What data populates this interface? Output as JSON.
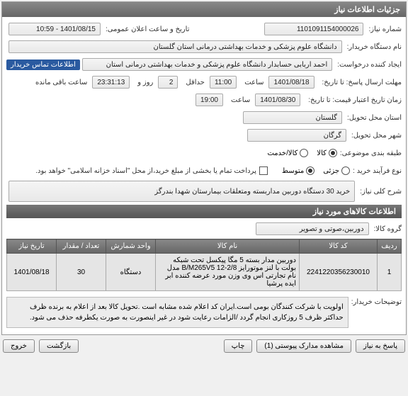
{
  "panel_title": "جزئیات اطلاعات نیاز",
  "fields": {
    "need_number_label": "شماره نیاز:",
    "need_number": "1101091154000026",
    "announce_label": "تاریخ و ساعت اعلان عمومی:",
    "announce_value": "1401/08/15 - 10:59",
    "buyer_org_label": "نام دستگاه خریدار:",
    "buyer_org": "دانشگاه علوم پزشکی و خدمات بهداشتی درمانی استان گلستان",
    "creator_label": "ایجاد کننده درخواست:",
    "creator": "احمد اربابی حسابدار دانشگاه علوم پزشکی و خدمات بهداشتی درمانی استان",
    "contact_badge": "اطلاعات تماس خریدار",
    "deadline_label": "مهلت ارسال پاسخ: تا تاریخ:",
    "deadline_date": "1401/08/18",
    "time_label": "ساعت",
    "deadline_time": "11:00",
    "day_and_label": "روز و",
    "days_value": "2",
    "remaining_time": "23:31:13",
    "remaining_label": "ساعت باقی مانده",
    "min_label": "حداقل",
    "credit_label": "زمان تاریخ اعتبار قیمت: تا تاریخ:",
    "credit_date": "1401/08/30",
    "credit_time": "19:00",
    "province_label": "استان محل تحویل:",
    "province": "گلستان",
    "city_label": "شهر محل تحویل:",
    "city": "گرگان",
    "budget_label": "طبقه بندی موضوعی:",
    "budget_opts": {
      "kala": "کالا",
      "khadamat": "کالا/خدمت"
    },
    "process_label": "نوع فرآیند خرید :",
    "process_opts": {
      "joz": "جزئی",
      "moto": "متوسط"
    },
    "payment_text": "پرداخت تمام یا بخشی از مبلغ خرید،از محل \"اسناد خزانه اسلامی\" خواهد بود.",
    "summary_label": "شرح کلی نیاز:",
    "summary": "خرید 30 دستگاه دوربین مداربسته ومتعلقات بیمارستان شهدا بندرگز"
  },
  "items_section": {
    "header": "اطلاعات کالاهای مورد نیاز",
    "group_label": "گروه کالا:",
    "group_value": "دوربین،صوتی و تصویر"
  },
  "table": {
    "headers": [
      "ردیف",
      "کد کالا",
      "نام کالا",
      "واحد شمارش",
      "تعداد / مقدار",
      "تاریخ نیاز"
    ],
    "rows": [
      {
        "idx": "1",
        "code": "2241220356230010",
        "name": "دوربین مدار بسته 5 مگا پیکسل تحت شبکه بولت با لنز موتورایز B/M265V5 12-2/8 مدل نام تجارتی اس وی وزن مورد عرضه کننده ابر ایده پرشیا",
        "unit": "دستگاه",
        "qty": "30",
        "date": "1401/08/18"
      }
    ]
  },
  "notes": {
    "label": "توضیحات خریدار:",
    "text": "اولویت با شرکت کنندگان بومی است.ایران کد اعلام شده مشابه است .تحویل کالا بعد از اعلام به برنده ظرف حداکثر ظرف 5 روزکاری انجام گردد /الزامات رعایت شود در غیر اینصورت به صورت یکطرفه حذف می شود."
  },
  "buttons": {
    "reply": "پاسخ به نیاز",
    "attachments": "مشاهده مدارک پیوستی (1)",
    "print": "چاپ",
    "back": "بازگشت",
    "exit": "خروج"
  }
}
